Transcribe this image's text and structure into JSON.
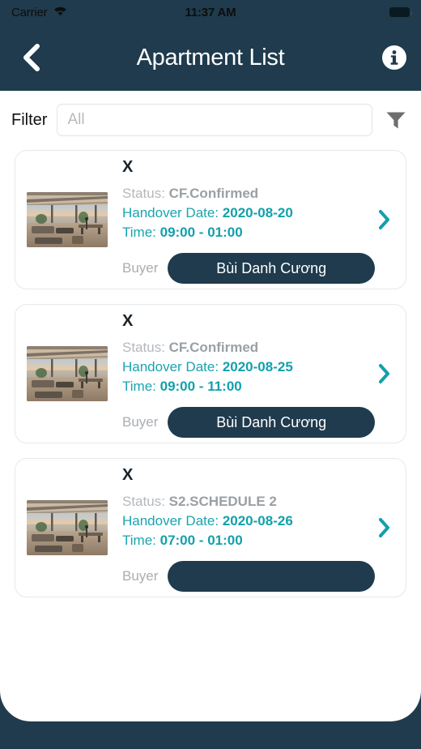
{
  "status_bar": {
    "carrier": "Carrier",
    "wifi_icon": "wifi-icon",
    "time": "11:37 AM",
    "battery_icon": "battery-full-icon"
  },
  "nav_bar": {
    "back_icon": "chevron-left-icon",
    "title": "Apartment List",
    "info_icon": "info-circle-icon"
  },
  "filter": {
    "label": "Filter",
    "value": "",
    "placeholder": "All",
    "funnel_icon": "funnel-filter-icon"
  },
  "colors": {
    "nav_background": "#1f3b4d",
    "accent_teal": "#12a0ab",
    "pill_background": "#1f3b4d",
    "card_border": "#e6e8ea",
    "muted_text": "#a9adb2"
  },
  "labels": {
    "status": "Status:",
    "handover_date": "Handover Date:",
    "time": "Time:",
    "buyer": "Buyer",
    "row_chevron_icon": "chevron-right-icon",
    "thumbnail_icon": "apartment-interior-photo"
  },
  "apartments": [
    {
      "name": "X",
      "status": "CF.Confirmed",
      "handover_date": "2020-08-20",
      "time": "09:00 - 01:00",
      "buyer": "Bùi Danh Cương"
    },
    {
      "name": "X",
      "status": "CF.Confirmed",
      "handover_date": "2020-08-25",
      "time": "09:00 - 11:00",
      "buyer": "Bùi Danh Cương"
    },
    {
      "name": "X",
      "status": "S2.SCHEDULE 2",
      "handover_date": "2020-08-26",
      "time": "07:00 - 01:00",
      "buyer": ""
    }
  ]
}
